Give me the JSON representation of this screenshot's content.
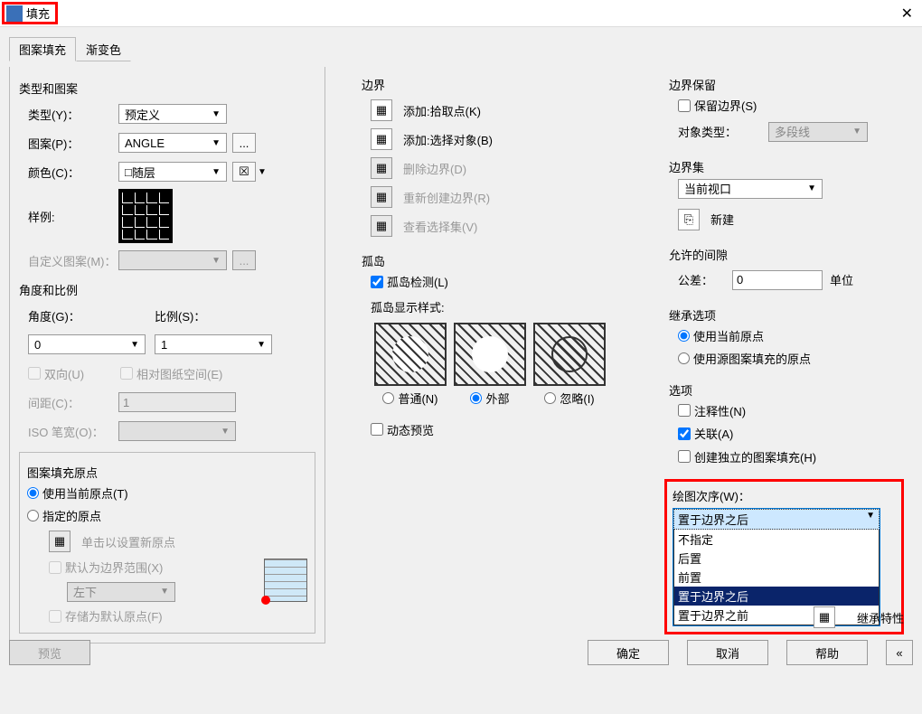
{
  "titlebar": {
    "title": "填充"
  },
  "tabs": {
    "tab1": "图案填充",
    "tab2": "渐变色"
  },
  "typePattern": {
    "group": "类型和图案",
    "type_lbl": "类型(Y)：",
    "type_val": "预定义",
    "pattern_lbl": "图案(P)：",
    "pattern_val": "ANGLE",
    "color_lbl": "颜色(C)：",
    "color_val": "随层",
    "sample_lbl": "样例:",
    "custom_lbl": "自定义图案(M)："
  },
  "angleScale": {
    "group": "角度和比例",
    "angle_lbl": "角度(G)：",
    "angle_val": "0",
    "scale_lbl": "比例(S)：",
    "scale_val": "1",
    "double_lbl": "双向(U)",
    "relative_lbl": "相对图纸空间(E)",
    "spacing_lbl": "间距(C)：",
    "spacing_val": "1",
    "iso_lbl": "ISO 笔宽(O)："
  },
  "origin": {
    "group": "图案填充原点",
    "use_current": "使用当前原点(T)",
    "specify": "指定的原点",
    "click_new": "单击以设置新原点",
    "default_bounds": "默认为边界范围(X)",
    "pos_val": "左下",
    "store_default": "存储为默认原点(F)"
  },
  "boundary": {
    "group": "边界",
    "add_pick": "添加:拾取点(K)",
    "add_select": "添加:选择对象(B)",
    "delete": "删除边界(D)",
    "recreate": "重新创建边界(R)",
    "view_sel": "查看选择集(V)"
  },
  "islands": {
    "group": "孤岛",
    "detect": "孤岛检测(L)",
    "style": "孤岛显示样式:",
    "normal": "普通(N)",
    "outer": "外部",
    "ignore": "忽略(I)",
    "dyn_preview": "动态预览"
  },
  "bRetain": {
    "group": "边界保留",
    "retain": "保留边界(S)",
    "objtype_lbl": "对象类型：",
    "objtype_val": "多段线"
  },
  "bSet": {
    "group": "边界集",
    "val": "当前视口",
    "new_btn": "新建"
  },
  "gap": {
    "group": "允许的间隙",
    "tol_lbl": "公差：",
    "tol_val": "0",
    "unit": "单位"
  },
  "inherit": {
    "group": "继承选项",
    "use_current": "使用当前原点",
    "use_source": "使用源图案填充的原点"
  },
  "options": {
    "group": "选项",
    "annot": "注释性(N)",
    "assoc": "关联(A)",
    "indep": "创建独立的图案填充(H)"
  },
  "drawOrder": {
    "label": "绘图次序(W)：",
    "selected": "置于边界之后",
    "opts": [
      "不指定",
      "后置",
      "前置",
      "置于边界之后",
      "置于边界之前"
    ]
  },
  "inheritProps": "继承特性",
  "buttons": {
    "preview": "预览",
    "ok": "确定",
    "cancel": "取消",
    "help": "帮助"
  }
}
